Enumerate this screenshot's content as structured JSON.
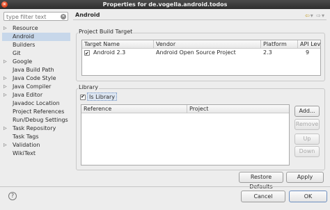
{
  "window": {
    "title": "Properties for de.vogella.android.todos"
  },
  "sidebar": {
    "filter_placeholder": "type filter text",
    "items": [
      {
        "label": "Resource",
        "expandable": true
      },
      {
        "label": "Android",
        "expandable": false,
        "selected": true
      },
      {
        "label": "Builders",
        "expandable": false
      },
      {
        "label": "Git",
        "expandable": false
      },
      {
        "label": "Google",
        "expandable": true
      },
      {
        "label": "Java Build Path",
        "expandable": false
      },
      {
        "label": "Java Code Style",
        "expandable": true
      },
      {
        "label": "Java Compiler",
        "expandable": true
      },
      {
        "label": "Java Editor",
        "expandable": true
      },
      {
        "label": "Javadoc Location",
        "expandable": false
      },
      {
        "label": "Project References",
        "expandable": false
      },
      {
        "label": "Run/Debug Settings",
        "expandable": false
      },
      {
        "label": "Task Repository",
        "expandable": true
      },
      {
        "label": "Task Tags",
        "expandable": false
      },
      {
        "label": "Validation",
        "expandable": true
      },
      {
        "label": "WikiText",
        "expandable": false
      }
    ]
  },
  "main": {
    "title": "Android",
    "build_target": {
      "group_label": "Project Build Target",
      "columns": [
        "Target Name",
        "Vendor",
        "Platform",
        "API Leve"
      ],
      "rows": [
        {
          "checked": true,
          "target_name": "Android 2.3",
          "vendor": "Android Open Source Project",
          "platform": "2.3",
          "api_level": "9"
        }
      ]
    },
    "library": {
      "group_label": "Library",
      "is_library_label": "Is Library",
      "is_library_checked": true,
      "columns": [
        "Reference",
        "Project"
      ],
      "buttons": {
        "add": "Add...",
        "remove": "Remove",
        "up": "Up",
        "down": "Down"
      }
    },
    "restore_defaults_label": "Restore Defaults",
    "apply_label": "Apply"
  },
  "footer": {
    "cancel_label": "Cancel",
    "ok_label": "OK",
    "help_glyph": "?"
  },
  "icons": {
    "help": "help-icon",
    "back": "back-arrow-icon",
    "forward": "forward-arrow-icon",
    "clear": "clear-filter-icon",
    "close": "close-icon"
  }
}
